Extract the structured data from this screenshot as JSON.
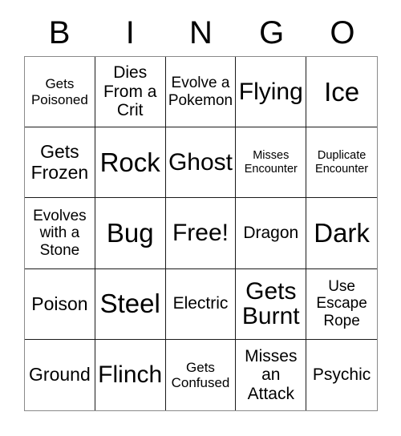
{
  "card": {
    "title": "BINGO",
    "header_letters": [
      "B",
      "I",
      "N",
      "G",
      "O"
    ],
    "colors": {
      "background": "#ffffff",
      "text": "#000000",
      "grid_inner_border": "#1a1a1a",
      "grid_outer_border": "#8a8a8a"
    },
    "grid": {
      "columns": 5,
      "rows": 5,
      "free_space_index": 12
    },
    "cells": [
      {
        "text": "Gets\nPoisoned",
        "size": "fs-s",
        "name": "cell-b1"
      },
      {
        "text": "Dies\nFrom a\nCrit",
        "size": "fs-m",
        "name": "cell-i1"
      },
      {
        "text": "Evolve a\nPokemon",
        "size": "fs-sm",
        "name": "cell-n1"
      },
      {
        "text": "Flying",
        "size": "fs-xl",
        "name": "cell-g1"
      },
      {
        "text": "Ice",
        "size": "fs-xxl",
        "name": "cell-o1"
      },
      {
        "text": "Gets\nFrozen",
        "size": "fs-ml",
        "name": "cell-b2"
      },
      {
        "text": "Rock",
        "size": "fs-xxl",
        "name": "cell-i2"
      },
      {
        "text": "Ghost",
        "size": "fs-xl",
        "name": "cell-n2"
      },
      {
        "text": "Misses\nEncounter",
        "size": "fs-xs",
        "name": "cell-g2"
      },
      {
        "text": "Duplicate\nEncounter",
        "size": "fs-xs",
        "name": "cell-o2"
      },
      {
        "text": "Evolves\nwith a\nStone",
        "size": "fs-sm",
        "name": "cell-b3"
      },
      {
        "text": "Bug",
        "size": "fs-xxl",
        "name": "cell-i3"
      },
      {
        "text": "Free!",
        "size": "fs-xl",
        "name": "cell-n3"
      },
      {
        "text": "Dragon",
        "size": "fs-m",
        "name": "cell-g3"
      },
      {
        "text": "Dark",
        "size": "fs-xxl",
        "name": "cell-o3"
      },
      {
        "text": "Poison",
        "size": "fs-ml",
        "name": "cell-b4"
      },
      {
        "text": "Steel",
        "size": "fs-xxl",
        "name": "cell-i4"
      },
      {
        "text": "Electric",
        "size": "fs-m",
        "name": "cell-n4"
      },
      {
        "text": "Gets\nBurnt",
        "size": "fs-xl",
        "name": "cell-g4"
      },
      {
        "text": "Use\nEscape\nRope",
        "size": "fs-sm",
        "name": "cell-o4"
      },
      {
        "text": "Ground",
        "size": "fs-ml",
        "name": "cell-b5"
      },
      {
        "text": "Flinch",
        "size": "fs-xl",
        "name": "cell-i5"
      },
      {
        "text": "Gets\nConfused",
        "size": "fs-s",
        "name": "cell-n5"
      },
      {
        "text": "Misses\nan\nAttack",
        "size": "fs-m",
        "name": "cell-g5"
      },
      {
        "text": "Psychic",
        "size": "fs-m",
        "name": "cell-o5"
      }
    ]
  }
}
